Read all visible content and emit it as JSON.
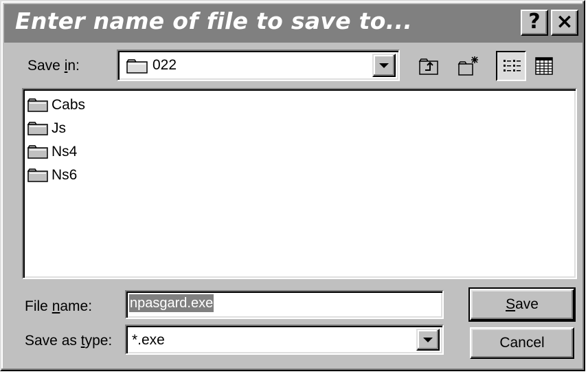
{
  "window": {
    "title": "Enter name of file to save to...",
    "help_button": "?",
    "close_button": "×"
  },
  "save_in": {
    "label_pre": "Save ",
    "label_u": "i",
    "label_post": "n:",
    "value": "022"
  },
  "files": [
    {
      "name": "Cabs",
      "type": "folder-icon"
    },
    {
      "name": "Js",
      "type": "folder-icon"
    },
    {
      "name": "Ns4",
      "type": "folder-icon"
    },
    {
      "name": "Ns6",
      "type": "folder-icon"
    }
  ],
  "file_name": {
    "label_pre": "File ",
    "label_u": "n",
    "label_post": "ame:",
    "value": "npasgard.exe"
  },
  "save_type": {
    "label_pre": "Save as ",
    "label_u": "t",
    "label_post": "ype:",
    "value": "*.exe"
  },
  "buttons": {
    "save_u": "S",
    "save_rest": "ave",
    "cancel": "Cancel"
  },
  "colors": {
    "face": "#c0c0c0",
    "titlebar": "#808080",
    "selection": "#808080"
  }
}
